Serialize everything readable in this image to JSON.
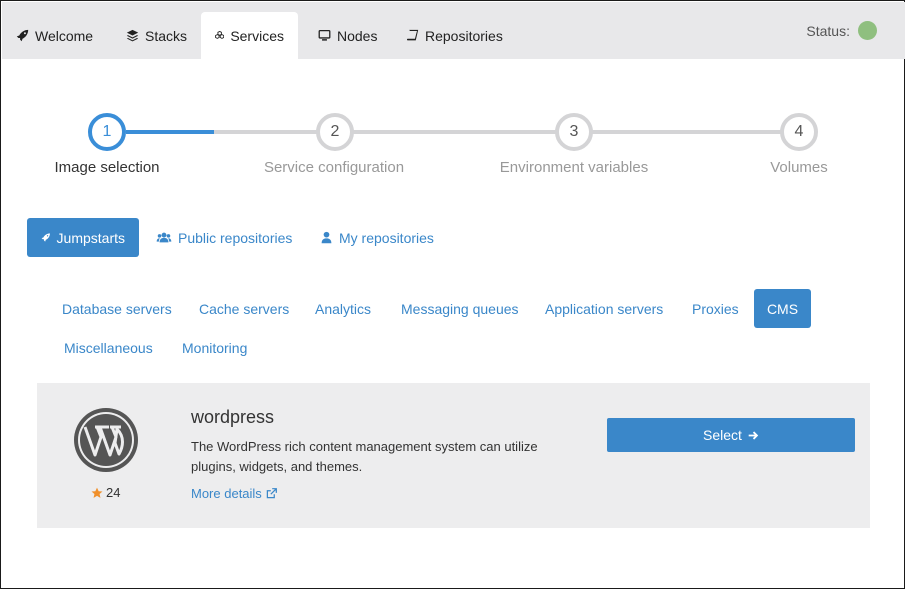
{
  "nav": {
    "tabs": [
      {
        "label": "Welcome",
        "icon": "rocket-icon"
      },
      {
        "label": "Stacks",
        "icon": "layers-icon"
      },
      {
        "label": "Services",
        "icon": "cubes-icon",
        "active": true
      },
      {
        "label": "Nodes",
        "icon": "desktop-icon"
      },
      {
        "label": "Repositories",
        "icon": "book-icon"
      }
    ],
    "status_label": "Status:",
    "status_color": "#8fbf7f"
  },
  "stepper": {
    "steps": [
      {
        "number": "1",
        "label": "Image selection",
        "active": true
      },
      {
        "number": "2",
        "label": "Service configuration"
      },
      {
        "number": "3",
        "label": "Environment variables"
      },
      {
        "number": "4",
        "label": "Volumes"
      }
    ]
  },
  "sources": [
    {
      "label": "Jumpstarts",
      "icon": "rocket-icon",
      "active": true
    },
    {
      "label": "Public repositories",
      "icon": "users-icon"
    },
    {
      "label": "My repositories",
      "icon": "user-icon"
    }
  ],
  "categories": [
    {
      "label": "Database servers"
    },
    {
      "label": "Cache servers"
    },
    {
      "label": "Analytics"
    },
    {
      "label": "Messaging queues"
    },
    {
      "label": "Application servers"
    },
    {
      "label": "Proxies"
    },
    {
      "label": "CMS",
      "active": true
    },
    {
      "label": "Miscellaneous"
    },
    {
      "label": "Monitoring"
    }
  ],
  "result": {
    "name": "wordpress",
    "description": "The WordPress rich content management system can utilize plugins, widgets, and themes.",
    "stars": "24",
    "details_link": "More details",
    "select_label": "Select",
    "logo": "wordpress-logo"
  },
  "colors": {
    "accent": "#3a87c9",
    "navbar_bg": "#e8e8ea",
    "card_bg": "#ededee",
    "star": "#f0902b"
  }
}
